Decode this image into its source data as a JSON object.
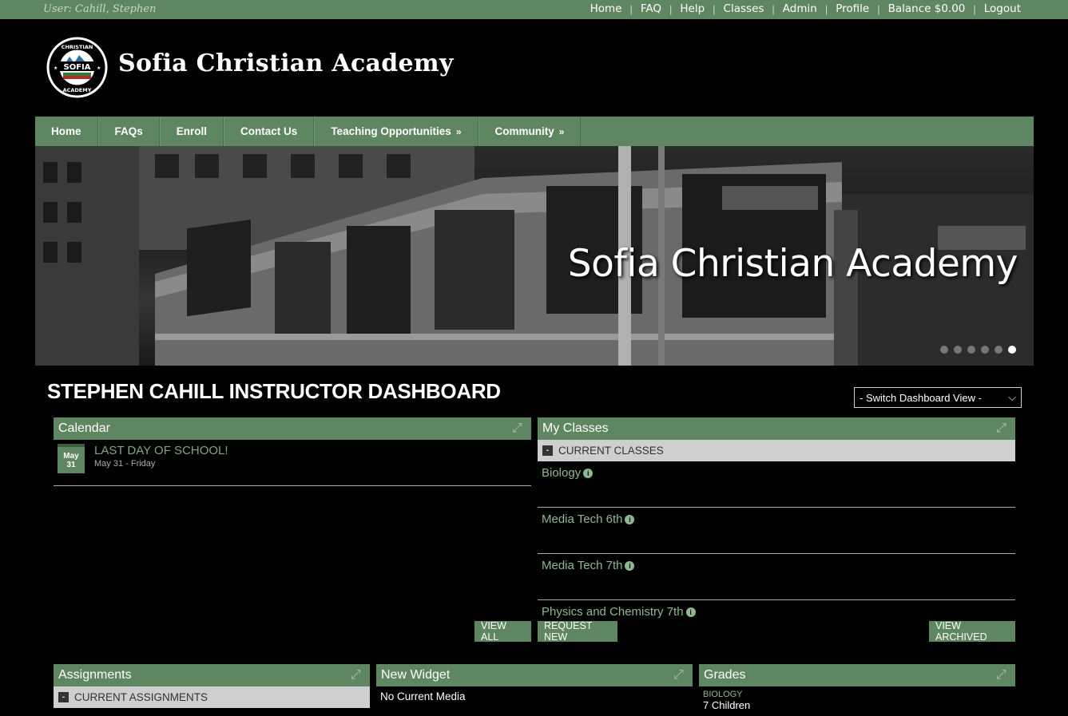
{
  "topbar": {
    "user": "User: Cahill, Stephen",
    "links": [
      "Home",
      "FAQ",
      "Help",
      "Classes",
      "Admin",
      "Profile",
      "Balance $0.00",
      "Logout"
    ],
    "separator": "|"
  },
  "brand": {
    "name": "Sofia Christian Academy",
    "logo_top": "CHRISTIAN",
    "logo_mid": "SOFIA",
    "logo_bottom": "ACADEMY"
  },
  "mainnav": {
    "items": [
      "Home",
      "FAQs",
      "Enroll",
      "Contact Us",
      "Teaching Opportunities",
      "Community"
    ],
    "submenu_marker": "»"
  },
  "banner": {
    "title": "Sofia Christian Academy",
    "slides": 6,
    "active_slide": 6
  },
  "dashboard": {
    "title": "STEPHEN CAHILL INSTRUCTOR DASHBOARD",
    "switch_view": "- Switch Dashboard View -"
  },
  "calendar": {
    "title": "Calendar",
    "event": {
      "month": "May",
      "day": "31",
      "title": "LAST DAY OF SCHOOL!",
      "date": "May 31 - Friday"
    },
    "view_all": "VIEW ALL"
  },
  "my_classes": {
    "title": "My Classes",
    "section": "CURRENT CLASSES",
    "classes": [
      "Biology",
      "Media Tech 6th",
      "Media Tech 7th",
      "Physics and Chemistry 7th"
    ],
    "request_new": "REQUEST NEW",
    "view_archived": "VIEW ARCHIVED"
  },
  "assignments": {
    "title": "Assignments",
    "section": "CURRENT ASSIGNMENTS"
  },
  "new_widget": {
    "title": "New Widget",
    "text": "No Current Media"
  },
  "grades": {
    "title": "Grades",
    "course": "BIOLOGY",
    "children": "7 Children"
  },
  "colors": {
    "accent": "#5e8660",
    "link": "#8fb790"
  }
}
